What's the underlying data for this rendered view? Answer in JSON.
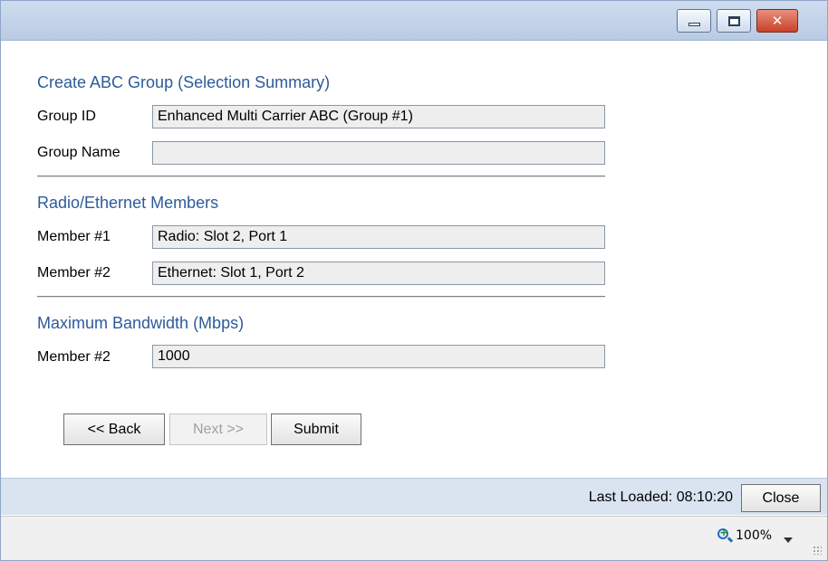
{
  "window": {
    "buttons": {
      "minimize": "minimize-icon",
      "maximize": "maximize-icon",
      "close": "close-icon"
    }
  },
  "form": {
    "section1_title": "Create ABC Group (Selection Summary)",
    "group_id_label": "Group ID",
    "group_id_value": "Enhanced Multi Carrier ABC (Group #1)",
    "group_name_label": "Group Name",
    "group_name_value": "",
    "section2_title": "Radio/Ethernet Members",
    "member1_label": "Member #1",
    "member1_value": "Radio: Slot 2, Port 1",
    "member2_label": "Member #2",
    "member2_value": "Ethernet: Slot 1, Port 2",
    "section3_title": "Maximum Bandwidth (Mbps)",
    "bandwidth_label": "Member #2",
    "bandwidth_value": "1000"
  },
  "buttons": {
    "back": "<< Back",
    "next": "Next >>",
    "submit": "Submit"
  },
  "footer": {
    "last_loaded": "Last Loaded: 08:10:20",
    "close": "Close"
  },
  "statusbar": {
    "zoom_icon": "zoom-in-icon",
    "zoom": "100%"
  }
}
